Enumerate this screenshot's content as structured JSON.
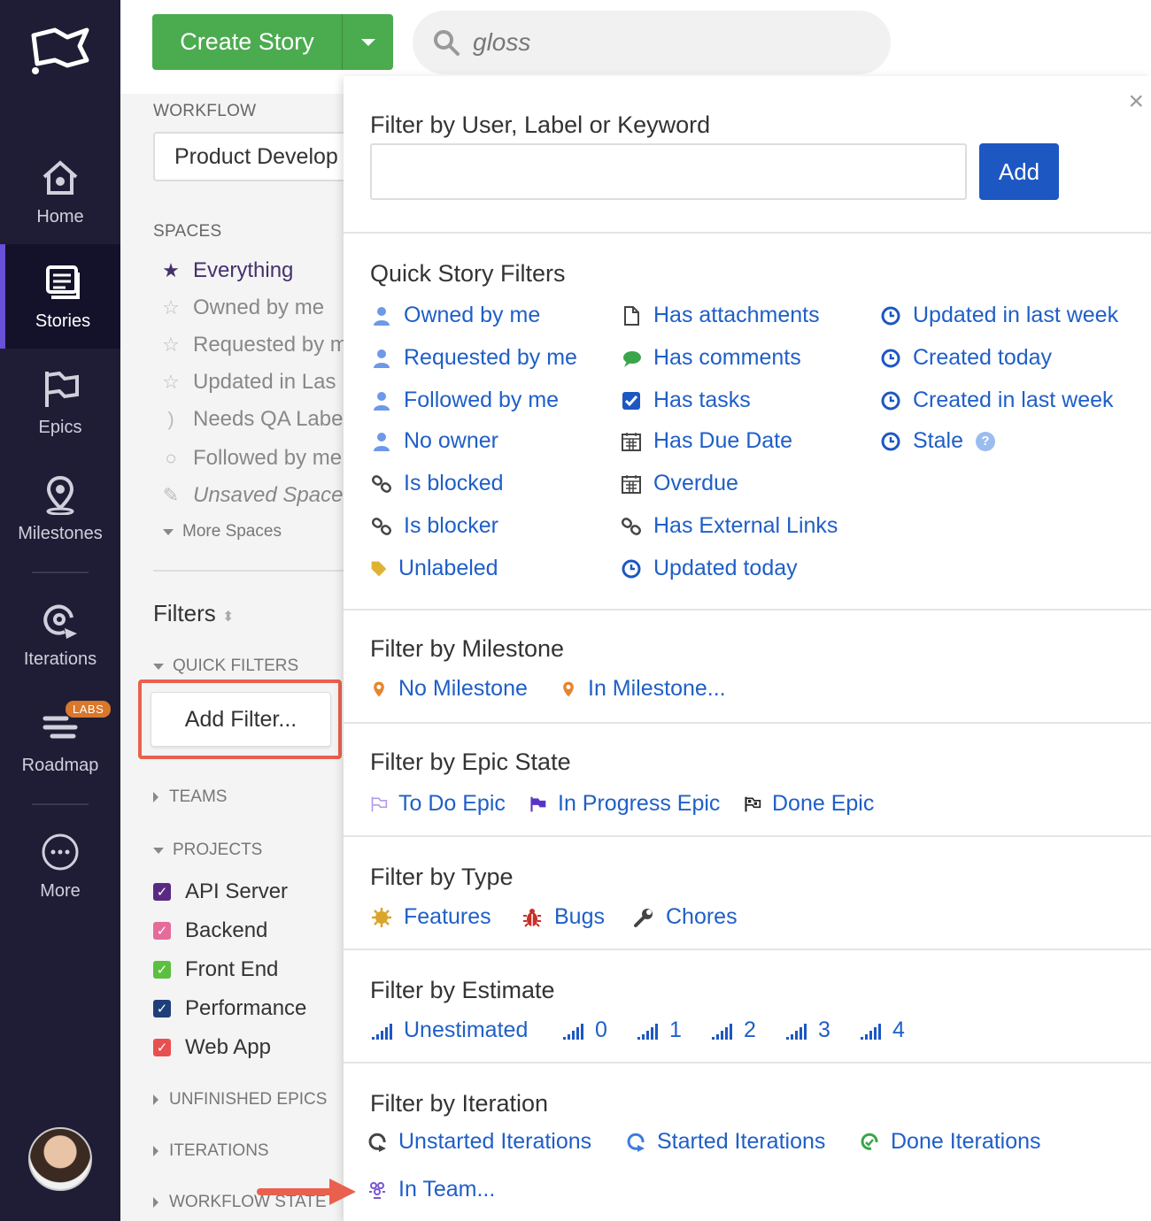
{
  "nav": {
    "items": [
      {
        "label": "Home",
        "icon": "home-icon"
      },
      {
        "label": "Stories",
        "icon": "stories-icon"
      },
      {
        "label": "Epics",
        "icon": "epics-icon"
      },
      {
        "label": "Milestones",
        "icon": "milestone-icon"
      },
      {
        "label": "Iterations",
        "icon": "iterations-icon"
      },
      {
        "label": "Roadmap",
        "icon": "roadmap-icon"
      },
      {
        "label": "More",
        "icon": "more-icon"
      }
    ],
    "labs_badge": "LABS",
    "active": "Stories"
  },
  "topbar": {
    "create_label": "Create Story",
    "search_value": "gloss"
  },
  "sidebar": {
    "workflow_label": "WORKFLOW",
    "workflow_value": "Product Develop",
    "spaces_label": "SPACES",
    "spaces": [
      {
        "label": "Everything",
        "icon": "star-filled-icon"
      },
      {
        "label": "Owned by me",
        "icon": "star-icon"
      },
      {
        "label": "Requested by m",
        "icon": "star-icon"
      },
      {
        "label": "Updated in Las",
        "icon": "star-icon"
      },
      {
        "label": "Needs QA Labe",
        "icon": "rss-icon"
      },
      {
        "label": "Followed by me",
        "icon": "circle-icon"
      },
      {
        "label": "Unsaved Space",
        "icon": "edit-icon"
      }
    ],
    "more_spaces": "More Spaces",
    "filters_title": "Filters",
    "quick_filters": "QUICK FILTERS",
    "add_filter": "Add Filter...",
    "teams": "TEAMS",
    "projects_label": "PROJECTS",
    "projects": [
      {
        "label": "API Server",
        "color": "#5a2a82"
      },
      {
        "label": "Backend",
        "color": "#e56b9a"
      },
      {
        "label": "Front End",
        "color": "#5bbf3f"
      },
      {
        "label": "Performance",
        "color": "#1f3f7a"
      },
      {
        "label": "Web App",
        "color": "#e8504f"
      }
    ],
    "unfinished_epics": "UNFINISHED EPICS",
    "iterations": "ITERATIONS",
    "workflow_state": "WORKFLOW STATE"
  },
  "popover": {
    "close": "×",
    "keyword": {
      "title": "Filter by User, Label or Keyword",
      "add_label": "Add",
      "value": ""
    },
    "quick": {
      "title": "Quick Story Filters",
      "col1": [
        {
          "label": "Owned by me",
          "icon": "user-icon"
        },
        {
          "label": "Requested by me",
          "icon": "user-icon"
        },
        {
          "label": "Followed by me",
          "icon": "user-icon"
        },
        {
          "label": "No owner",
          "icon": "user-icon"
        },
        {
          "label": "Is blocked",
          "icon": "link-icon"
        },
        {
          "label": "Is blocker",
          "icon": "link-icon"
        },
        {
          "label": "Unlabeled",
          "icon": "tag-icon"
        }
      ],
      "col2": [
        {
          "label": "Has attachments",
          "icon": "file-icon"
        },
        {
          "label": "Has comments",
          "icon": "comment-icon"
        },
        {
          "label": "Has tasks",
          "icon": "checkbox-icon"
        },
        {
          "label": "Has Due Date",
          "icon": "calendar-icon"
        },
        {
          "label": "Overdue",
          "icon": "calendar-icon"
        },
        {
          "label": "Has External Links",
          "icon": "link-icon"
        },
        {
          "label": "Updated today",
          "icon": "clock-icon"
        }
      ],
      "col3": [
        {
          "label": "Updated in last week",
          "icon": "clock-icon"
        },
        {
          "label": "Created today",
          "icon": "clock-icon"
        },
        {
          "label": "Created in last week",
          "icon": "clock-icon"
        },
        {
          "label": "Stale",
          "icon": "clock-icon"
        }
      ]
    },
    "milestone": {
      "title": "Filter by Milestone",
      "items": [
        "No Milestone",
        "In Milestone..."
      ]
    },
    "epic_state": {
      "title": "Filter by Epic State",
      "items": [
        "To Do Epic",
        "In Progress Epic",
        "Done Epic"
      ]
    },
    "type": {
      "title": "Filter by Type",
      "items": [
        "Features",
        "Bugs",
        "Chores"
      ]
    },
    "estimate": {
      "title": "Filter by Estimate",
      "items": [
        "Unestimated",
        "0",
        "1",
        "2",
        "3",
        "4"
      ]
    },
    "iteration": {
      "title": "Filter by Iteration",
      "items": [
        "Unstarted Iterations",
        "Started Iterations",
        "Done Iterations",
        "In Team..."
      ]
    }
  },
  "colors": {
    "link": "#1f5fc7",
    "create": "#4bab4f",
    "add": "#1d57c2",
    "highlight": "#e9614e",
    "nav": "#1f1d35"
  }
}
